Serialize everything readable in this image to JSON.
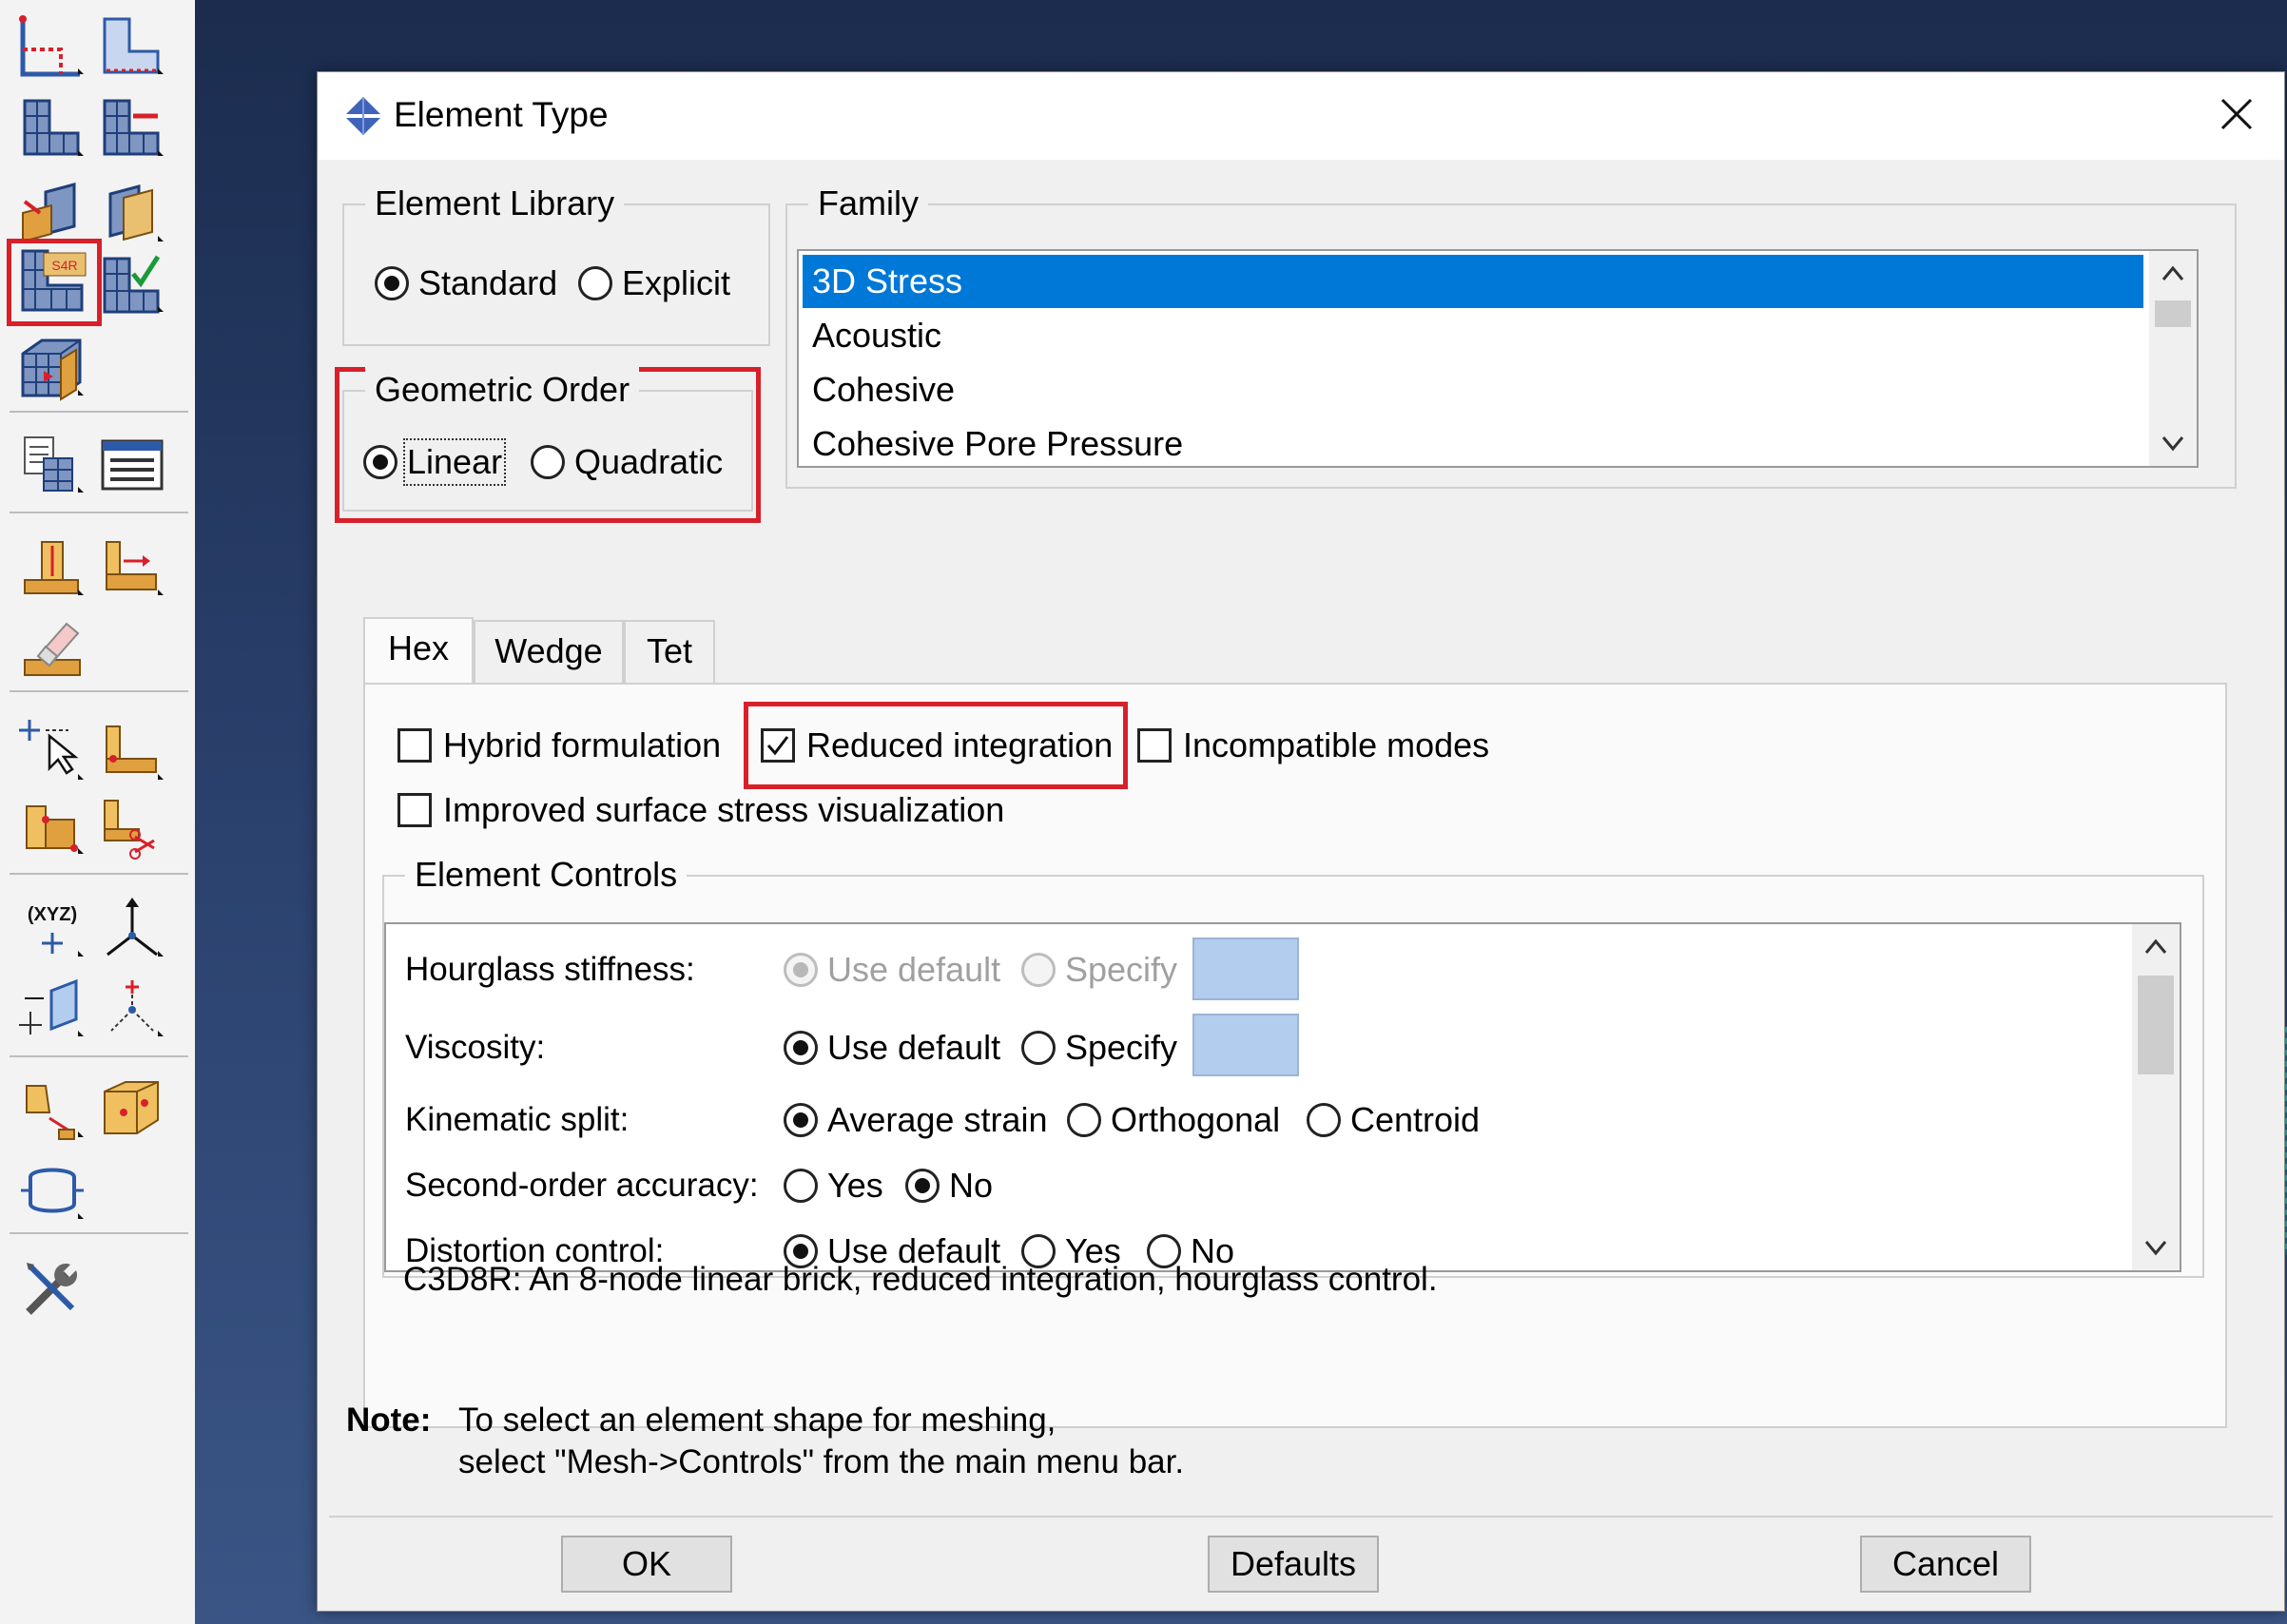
{
  "toolbox": {
    "tools": [
      "seed-part-icon",
      "seed-edge-icon",
      "mesh-part-icon",
      "mesh-region-icon",
      "partition-face-icon",
      "partition-cell-icon",
      "assign-element-type-icon",
      "verify-mesh-icon",
      "assign-mesh-controls-icon",
      "query-icon",
      "element-list-icon",
      "create-bottom-up-mesh-icon",
      "associate-mesh-icon",
      "delete-mesh-icon",
      "create-node-icon",
      "edit-mesh-icon",
      "create-element-icon",
      "split-element-icon",
      "create-datum-point-icon",
      "create-datum-csys-icon",
      "create-datum-plane-icon",
      "create-datum-axis-icon",
      "create-display-group-icon",
      "create-set-icon",
      "create-surface-icon",
      "tools-icon"
    ],
    "highlighted": "assign-element-type-icon",
    "seed_label": "S4R",
    "xyz_label": "(XYZ)"
  },
  "dialog": {
    "title": "Element Type",
    "library": {
      "title": "Element Library",
      "options": [
        "Standard",
        "Explicit"
      ],
      "selected": "Standard"
    },
    "geometric_order": {
      "title": "Geometric Order",
      "options": [
        "Linear",
        "Quadratic"
      ],
      "selected": "Linear"
    },
    "family": {
      "title": "Family",
      "items": [
        "3D Stress",
        "Acoustic",
        "Cohesive",
        "Cohesive Pore Pressure"
      ],
      "selected": "3D Stress"
    },
    "tabs": [
      "Hex",
      "Wedge",
      "Tet"
    ],
    "active_tab": "Hex",
    "options": {
      "hybrid": {
        "label": "Hybrid formulation",
        "checked": false
      },
      "reduced": {
        "label": "Reduced integration",
        "checked": true
      },
      "incompatible": {
        "label": "Incompatible modes",
        "checked": false
      },
      "improved": {
        "label": "Improved surface stress visualization",
        "checked": false
      }
    },
    "element_controls": {
      "title": "Element Controls",
      "rows": [
        {
          "label": "Hourglass stiffness:",
          "options": [
            "Use default",
            "Specify"
          ],
          "selected": "Use default",
          "disabled": true
        },
        {
          "label": "Viscosity:",
          "options": [
            "Use default",
            "Specify"
          ],
          "selected": "Use default",
          "disabled": false
        },
        {
          "label": "Kinematic split:",
          "options": [
            "Average strain",
            "Orthogonal",
            "Centroid"
          ],
          "selected": "Average strain",
          "disabled": false
        },
        {
          "label": "Second-order accuracy:",
          "options": [
            "Yes",
            "No"
          ],
          "selected": "No",
          "disabled": false
        },
        {
          "label": "Distortion control:",
          "options": [
            "Use default",
            "Yes",
            "No"
          ],
          "selected": "Use default",
          "disabled": false
        }
      ]
    },
    "description": "C3D8R:  An 8-node linear brick, reduced integration, hourglass control.",
    "note": {
      "label": "Note:",
      "line1": "To select an element shape for meshing,",
      "line2": "select \"Mesh->Controls\" from the main menu bar."
    },
    "buttons": {
      "ok": "OK",
      "defaults": "Defaults",
      "cancel": "Cancel"
    }
  },
  "colors": {
    "highlight_red": "#d8202a",
    "selection_blue": "#0078d7",
    "swatch": "#b3cdef",
    "viewport": "#2c4370"
  }
}
